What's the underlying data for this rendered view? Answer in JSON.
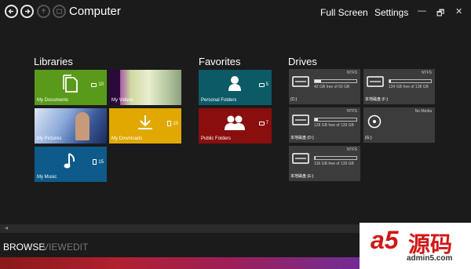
{
  "window": {
    "title": "Computer",
    "menu": {
      "fullscreen": "Full Screen",
      "settings": "Settings"
    },
    "controls": {
      "minimize": "—",
      "restore": "🗗",
      "close": "✕"
    }
  },
  "libraries": {
    "heading": "Libraries",
    "tiles": [
      {
        "label": "My Documents",
        "count": "10",
        "color": "#5a9a1a"
      },
      {
        "label": "My Videos",
        "count": "",
        "color": "#7a1a9a"
      },
      {
        "label": "My Pictures",
        "count": "",
        "color": "#4a6a9a"
      },
      {
        "label": "My Downloads",
        "count": "10",
        "color": "#e0a800"
      },
      {
        "label": "My Music",
        "count": "15",
        "color": "#0e5a8a"
      }
    ]
  },
  "favorites": {
    "heading": "Favorites",
    "tiles": [
      {
        "label": "Personal Folders",
        "count": "5",
        "color": "#0c5a66"
      },
      {
        "label": "Public Folders",
        "count": "7",
        "color": "#8a0e0e"
      }
    ]
  },
  "drives": {
    "heading": "Drives",
    "items": [
      {
        "name": "(C:)",
        "fs": "NTFS",
        "free_text": "42 GB free of 50 GB",
        "used_fraction": 0.16
      },
      {
        "name": "本地磁盘 (F:)",
        "fs": "NTFS",
        "free_text": "134 GB free of 138 GB",
        "used_fraction": 0.03
      },
      {
        "name": "本地磁盘 (D:)",
        "fs": "NTFS",
        "free_text": "128 GB free of 139 GB",
        "used_fraction": 0.08
      },
      {
        "name": "(G:)",
        "fs": "No Media",
        "free_text": "",
        "used_fraction": null
      },
      {
        "name": "本地磁盘 (E:)",
        "fs": "NTFS",
        "free_text": "136 GB free of 139 GB",
        "used_fraction": 0.02
      }
    ]
  },
  "bottom": {
    "tabs": [
      "BROWSE",
      "VIEW",
      "EDIT"
    ],
    "scroll_arrow": "◂"
  },
  "watermark": {
    "brand": "a5",
    "cn": "源码",
    "url": "admin5.com"
  }
}
